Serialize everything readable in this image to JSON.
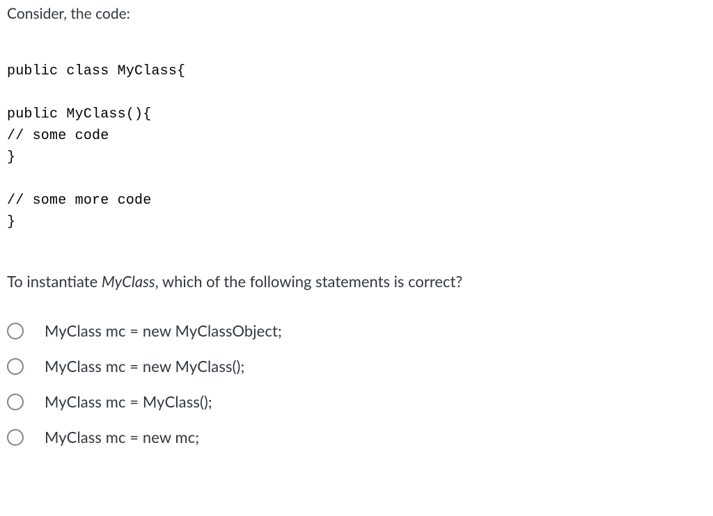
{
  "intro": "Consider, the code:",
  "code": "public class MyClass{\n\npublic MyClass(){\n// some code\n}\n\n// some more code\n}",
  "question": {
    "prefix": "To instantiate ",
    "em": "MyClass",
    "suffix": ", which of the following statements is correct?"
  },
  "options": [
    "MyClass mc = new MyClassObject;",
    "MyClass mc = new MyClass();",
    "MyClass mc = MyClass();",
    "MyClass mc = new mc;"
  ]
}
